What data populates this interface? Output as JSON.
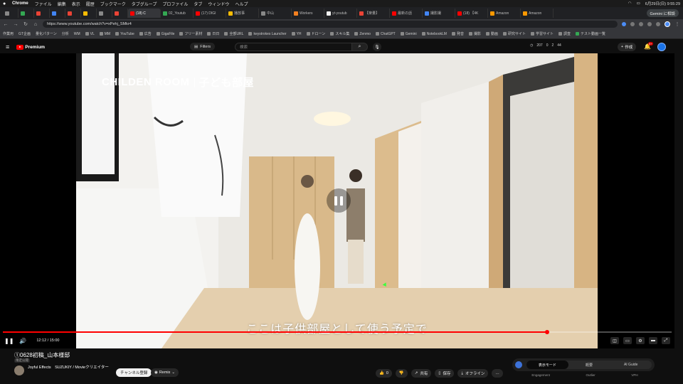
{
  "menubar": {
    "app": "Chrome",
    "items": [
      "ファイル",
      "編集",
      "表示",
      "履歴",
      "ブックマーク",
      "タブグループ",
      "プロファイル",
      "タブ",
      "ウィンドウ",
      "ヘルプ"
    ],
    "datetime": "6月29日(日) 9:55:29"
  },
  "tabs": [
    {
      "label": ""
    },
    {
      "label": ""
    },
    {
      "label": ""
    },
    {
      "label": ""
    },
    {
      "label": ""
    },
    {
      "label": ""
    },
    {
      "label": ""
    },
    {
      "label": ""
    },
    {
      "label": "(18) C",
      "active": true
    },
    {
      "label": "02_Youtub"
    },
    {
      "label": "(17) DIGI"
    },
    {
      "label": "播放事"
    },
    {
      "label": "中山"
    },
    {
      "label": "Workers"
    },
    {
      "label": "yt-youtub"
    },
    {
      "label": "【楽量】"
    },
    {
      "label": "最新の話"
    },
    {
      "label": "撮影撮"
    },
    {
      "label": "(18) 【4K"
    },
    {
      "label": "Amazon"
    },
    {
      "label": "Amazon"
    }
  ],
  "gemini_button": "Gemini に相談",
  "omnibox": {
    "url": "https://www.youtube.com/watch?v=xPehj_SMkr4"
  },
  "bookmarks": [
    "作業用",
    "GT企画",
    "量化パターン",
    "分析",
    "WM",
    "VL",
    "MM",
    "YouTube",
    "広告",
    "GigaFile",
    "フリー素材",
    "日日",
    "全部URL",
    "keystrokes Launcher",
    "YH",
    "ドローン",
    "スキル集",
    "Zenmo",
    "ChatGPT",
    "Gemini",
    "NotebookLM",
    "発音",
    "撮影",
    "動画",
    "研究サイト",
    "学習サイト",
    "調査",
    "テスト動画一覧"
  ],
  "yt_header": {
    "logo": "Premium",
    "filters": "Filters",
    "search_placeholder": "検索",
    "stats": [
      "207",
      "0",
      "2",
      "44"
    ],
    "create": "作成",
    "badge": "9+"
  },
  "video": {
    "title_left": "CHILDEN ROOM",
    "title_right": "子ども部屋",
    "subtitle": "ここは子供部屋として使う予定で",
    "time": "12:12 / 15:00",
    "progress": 0.8133
  },
  "below": {
    "title": "①0628初稿_山本様邸",
    "visibility": "限定公開",
    "channel": "Joyful Effects　SUZUKIY / Movieクリエイター",
    "subscribe": "チャンネル登録",
    "remix": "Remix",
    "like_count": "0",
    "share": "共有",
    "save": "保存",
    "offline": "オフライン",
    "more": "…"
  },
  "panel": {
    "segments": [
      "表示モード",
      "概要",
      "AI Guide"
    ],
    "tabs": [
      "Engagement",
      "Outlier",
      "VPH"
    ]
  }
}
